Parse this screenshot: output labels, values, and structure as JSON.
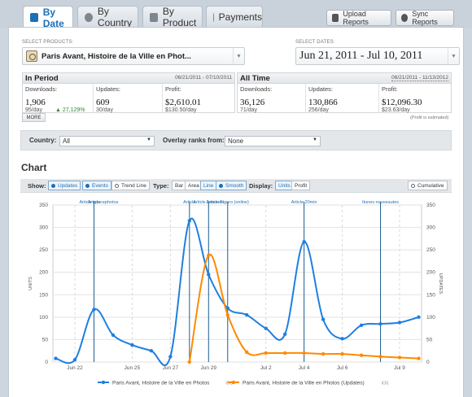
{
  "tabs": [
    {
      "label": "By Date",
      "active": true
    },
    {
      "label": "By Country",
      "active": false
    },
    {
      "label": "By Product",
      "active": false
    },
    {
      "label": "Payments",
      "active": false
    }
  ],
  "actions": {
    "upload": "Upload Reports",
    "sync": "Sync Reports"
  },
  "products": {
    "label": "SELECT PRODUCTS:",
    "value": "Paris Avant, Histoire de la Ville en Phot..."
  },
  "dates": {
    "label": "SELECT DATES:",
    "value": "Jun 21, 2011 - Jul 10, 2011"
  },
  "in_period": {
    "title": "In Period",
    "range": "06/21/2011 - 07/10/2011",
    "downloads_label": "Downloads:",
    "downloads": "1,906",
    "downloads_rate": "95/day",
    "downloads_change": "▲ 27,129%",
    "updates_label": "Updates:",
    "updates": "609",
    "updates_rate": "30/day",
    "profit_label": "Profit:",
    "profit": "$2,610.01",
    "profit_rate": "$130.50/day"
  },
  "all_time": {
    "title": "All Time",
    "range": "06/21/2011 - 11/13/2012",
    "downloads_label": "Downloads:",
    "downloads": "36,126",
    "downloads_rate": "71/day",
    "updates_label": "Updates:",
    "updates": "130,866",
    "updates_rate": "256/day",
    "profit_label": "Profit:",
    "profit": "$12,096.30",
    "profit_rate": "$23.63/day"
  },
  "more_label": "MORE",
  "profit_note": "(Profit is estimated)",
  "filters": {
    "country_label": "Country:",
    "country_value": "All",
    "overlay_label": "Overlay ranks from:",
    "overlay_value": "None"
  },
  "chart_title": "Chart",
  "chart_toolbar": {
    "show_label": "Show:",
    "updates": "Updates",
    "events": "Events",
    "trend": "Trend Line",
    "type_label": "Type:",
    "bar": "Bar",
    "area": "Area",
    "line": "Line",
    "smooth": "Smooth",
    "display_label": "Display:",
    "units": "Units",
    "profit": "Profit",
    "cumulative": "Cumulative"
  },
  "colors": {
    "series1": "#1f7fe0",
    "series2": "#ff8a00",
    "event": "#1a5f95"
  },
  "chart_data": {
    "type": "line",
    "x": [
      "Jun 21",
      "Jun 22",
      "Jun 23",
      "Jun 24",
      "Jun 25",
      "Jun 26",
      "Jun 27",
      "Jun 28",
      "Jun 29",
      "Jun 30",
      "Jul 1",
      "Jul 2",
      "Jul 3",
      "Jul 4",
      "Jul 5",
      "Jul 6",
      "Jul 7",
      "Jul 8",
      "Jul 9",
      "Jul 10"
    ],
    "x_tick_labels": [
      "Jun 22",
      "Jun 25",
      "Jun 27",
      "Jun 29",
      "Jul 2",
      "Jul 4",
      "Jul 6",
      "Jul 9"
    ],
    "series": [
      {
        "name": "Paris Avant, Histoire de la Ville en Photos",
        "platform": "iOS",
        "values": [
          8,
          5,
          117,
          60,
          38,
          25,
          12,
          315,
          195,
          120,
          105,
          75,
          62,
          268,
          95,
          52,
          82,
          85,
          88,
          100
        ]
      },
      {
        "name": "Paris Avant, Histoire de la Ville en Photos (Updates)",
        "platform": "iOS",
        "values": [
          0,
          0,
          0,
          0,
          0,
          0,
          0,
          0,
          238,
          105,
          22,
          20,
          20,
          20,
          18,
          18,
          15,
          12,
          10,
          8
        ]
      }
    ],
    "events": [
      {
        "x": "Jun 23",
        "label": "Article"
      },
      {
        "x": "Jun 23",
        "label": "Article spacephotos"
      },
      {
        "x": "Jun 28",
        "label": "Article"
      },
      {
        "x": "Jun 29",
        "label": "Article lemonde"
      },
      {
        "x": "Jun 30",
        "label": "Article Figaro (online)"
      },
      {
        "x": "Jul 4",
        "label": "Article 20min"
      },
      {
        "x": "Jul 8",
        "label": "Itunes nouveautes"
      }
    ],
    "ylabel": "UNITS",
    "ylabel_right": "UPDATES",
    "ylim": [
      0,
      350
    ],
    "yticks": [
      0,
      50,
      100,
      150,
      200,
      250,
      300,
      350
    ],
    "grid": true,
    "legend": "bottom"
  }
}
